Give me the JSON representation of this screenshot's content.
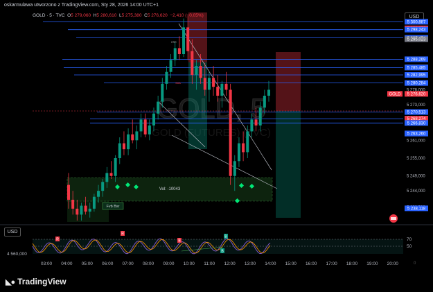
{
  "window": {
    "title": "oskarmulawa utworzono z TradingView.com, Sty 28, 2026 14:00 UTC+1",
    "currency_button": "USD"
  },
  "legend": {
    "symbol": "GOLD · 5 · TVC",
    "open_label": "O",
    "open": "5 279,060",
    "high_label": "H",
    "high": "5 280,610",
    "low_label": "L",
    "low": "5 275,380",
    "close_label": "C",
    "close": "5 276,620",
    "change": "−2,410 (−0,05%)"
  },
  "watermark": {
    "symbol": "GOLD, 5",
    "name": "GOLD (FUTURES) (TVC)"
  },
  "colors": {
    "up": "#089981",
    "down": "#f23645",
    "blue_line": "#2962ff",
    "zone_green": "#2e7d32",
    "last_price": "#f23645",
    "rsi_purple": "#7e57c2",
    "rsi_orange": "#ff9800"
  },
  "annotations": {
    "fvg_label": "Fvb Bsr",
    "vol_label": "Vol: -10043",
    "small_tag_1": "ERR",
    "small_tag_2": "SMA"
  },
  "osc": {
    "currency_button": "USD",
    "left_value": "4 560,000",
    "scale": [
      "70",
      "50",
      "0"
    ],
    "markers": [
      "R",
      "R",
      "B",
      "B",
      "B"
    ]
  },
  "footer": {
    "brand": "TradingView"
  },
  "chart_data": {
    "type": "candlestick",
    "symbol": "GOLD",
    "timeframe": "5",
    "source": "TVC",
    "x_labels": [
      "03:00",
      "04:00",
      "05:00",
      "06:00",
      "07:00",
      "08:00",
      "09:00",
      "10:00",
      "11:00",
      "12:00",
      "13:00",
      "14:00",
      "15:00",
      "16:00",
      "17:00",
      "18:00",
      "19:00",
      "20:00"
    ],
    "y_ticks": [
      "5 278,000",
      "5 273,000",
      "5 261,000",
      "5 255,000",
      "5 249,000",
      "5 244,000",
      "5 238,500"
    ],
    "y_range": [
      5234,
      5304
    ],
    "price_labels": [
      {
        "text": "5 300,887",
        "price": 5300.887,
        "color": "#2962ff"
      },
      {
        "text": "5 298,656",
        "price": 5298.656,
        "color": "#f23645"
      },
      {
        "text": "5 298,243",
        "price": 5298.243,
        "color": "#2962ff"
      },
      {
        "text": "5 295,454",
        "price": 5295.454,
        "color": "#2962ff"
      },
      {
        "text": "5 295,023",
        "price": 5295.023,
        "color": "#787b86"
      },
      {
        "text": "5 288,269",
        "price": 5288.269,
        "color": "#2962ff"
      },
      {
        "text": "5 285,526",
        "price": 5285.526,
        "color": "#787b86"
      },
      {
        "text": "5 285,485",
        "price": 5285.485,
        "color": "#2962ff"
      },
      {
        "text": "5 282,995",
        "price": 5282.995,
        "color": "#2962ff"
      },
      {
        "text": "5 280,284",
        "price": 5280.284,
        "color": "#2962ff"
      },
      {
        "text": "5 276,620",
        "price": 5276.62,
        "color": "#f23645",
        "tag": "GOLD"
      },
      {
        "text": "5 270,513",
        "price": 5270.513,
        "color": "#2962ff"
      },
      {
        "text": "5 268,275",
        "price": 5268.275,
        "color": "#2962ff"
      },
      {
        "text": "5 268,274",
        "price": 5268.274,
        "color": "#f23645"
      },
      {
        "text": "5 266,830",
        "price": 5266.83,
        "color": "#2962ff"
      },
      {
        "text": "5 263,315",
        "price": 5263.315,
        "color": "#2962ff"
      },
      {
        "text": "5 263,260",
        "price": 5263.26,
        "color": "#2962ff"
      },
      {
        "text": "5 238,118",
        "price": 5238.118,
        "color": "#2962ff"
      }
    ],
    "last_price": 5276.62,
    "candles": [
      [
        5246,
        5250,
        5238,
        5241
      ],
      [
        5241,
        5244,
        5236,
        5238
      ],
      [
        5238,
        5241,
        5234,
        5236
      ],
      [
        5236,
        5240,
        5234,
        5239
      ],
      [
        5239,
        5242,
        5236,
        5237
      ],
      [
        5237,
        5240,
        5235,
        5238
      ],
      [
        5238,
        5243,
        5237,
        5242
      ],
      [
        5242,
        5246,
        5240,
        5244
      ],
      [
        5244,
        5248,
        5242,
        5247
      ],
      [
        5247,
        5252,
        5245,
        5250
      ],
      [
        5250,
        5254,
        5248,
        5249
      ],
      [
        5249,
        5256,
        5247,
        5255
      ],
      [
        5255,
        5262,
        5253,
        5260
      ],
      [
        5260,
        5264,
        5256,
        5258
      ],
      [
        5258,
        5265,
        5256,
        5263
      ],
      [
        5263,
        5268,
        5260,
        5261
      ],
      [
        5261,
        5266,
        5258,
        5264
      ],
      [
        5264,
        5270,
        5262,
        5268
      ],
      [
        5268,
        5270,
        5262,
        5263
      ],
      [
        5263,
        5268,
        5261,
        5266
      ],
      [
        5266,
        5272,
        5264,
        5270
      ],
      [
        5270,
        5276,
        5268,
        5274
      ],
      [
        5274,
        5282,
        5272,
        5280
      ],
      [
        5280,
        5286,
        5278,
        5284
      ],
      [
        5284,
        5290,
        5282,
        5288
      ],
      [
        5288,
        5294,
        5286,
        5292
      ],
      [
        5292,
        5296,
        5288,
        5290
      ],
      [
        5290,
        5302,
        5289,
        5299
      ],
      [
        5299,
        5303,
        5288,
        5291
      ],
      [
        5291,
        5295,
        5280,
        5283
      ],
      [
        5283,
        5288,
        5278,
        5286
      ],
      [
        5286,
        5290,
        5280,
        5282
      ],
      [
        5282,
        5287,
        5276,
        5278
      ],
      [
        5278,
        5284,
        5274,
        5282
      ],
      [
        5282,
        5286,
        5276,
        5279
      ],
      [
        5279,
        5283,
        5274,
        5276
      ],
      [
        5276,
        5281,
        5272,
        5280
      ],
      [
        5280,
        5284,
        5276,
        5278
      ],
      [
        5278,
        5280,
        5246,
        5249
      ],
      [
        5249,
        5256,
        5244,
        5254
      ],
      [
        5254,
        5262,
        5252,
        5260
      ],
      [
        5260,
        5264,
        5254,
        5257
      ],
      [
        5257,
        5266,
        5255,
        5264
      ],
      [
        5264,
        5270,
        5262,
        5268
      ],
      [
        5268,
        5272,
        5264,
        5266
      ],
      [
        5266,
        5274,
        5264,
        5272
      ],
      [
        5272,
        5278,
        5270,
        5276
      ],
      [
        5276,
        5281,
        5274,
        5278
      ]
    ],
    "rsi_levels": [
      70,
      50
    ]
  }
}
